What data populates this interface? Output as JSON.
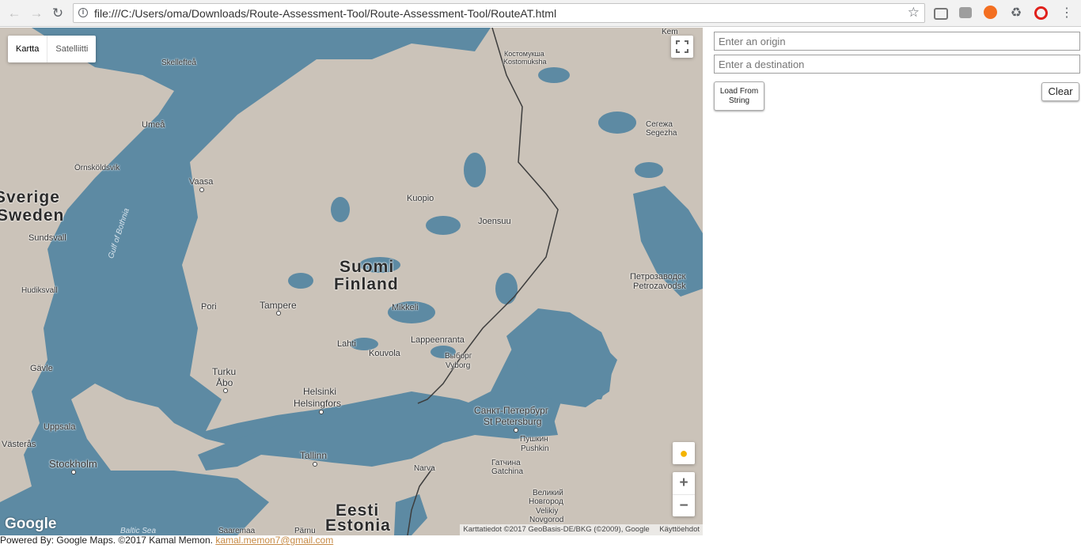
{
  "browser": {
    "url": "file:///C:/Users/oma/Downloads/Route-Assessment-Tool/Route-Assessment-Tool/RouteAT.html"
  },
  "map": {
    "type_controls": {
      "map_label": "Kartta",
      "satellite_label": "Satelliitti"
    },
    "labels": {
      "suomi": "Suomi",
      "finland": "Finland",
      "sverige": "Sverige",
      "sweden": "Sweden",
      "eesti": "Eesti",
      "estonia": "Estonia",
      "gulf_of_bothnia": "Gulf of Bothnia",
      "baltic_sea": "Baltic Sea",
      "skelleftea": "Skellefteå",
      "umea": "Umeå",
      "ornskoldsvik": "Örnsköldsvik",
      "vaasa": "Vaasa",
      "sundsvall": "Sundsvall",
      "hudiksvall": "Hudiksvall",
      "gavle": "Gävle",
      "uppsala": "Uppsala",
      "vasteras": "Västerås",
      "stockholm": "Stockholm",
      "pori": "Pori",
      "tampere": "Tampere",
      "turku": "Turku",
      "abo": "Åbo",
      "helsinki": "Helsinki",
      "helsingfors": "Helsingfors",
      "lahti": "Lahti",
      "kouvola": "Kouvola",
      "mikkeli": "Mikkeli",
      "kuopio": "Kuopio",
      "joensuu": "Joensuu",
      "lappeenranta": "Lappeenranta",
      "vyborg_ru": "Выборг",
      "vyborg": "Vyborg",
      "spb_ru": "Санкт-Петербург",
      "spb": "St Petersburg",
      "pushkin_ru": "Пушкин",
      "pushkin": "Pushkin",
      "gatchina_ru": "Гатчина",
      "gatchina": "Gatchina",
      "narva": "Narva",
      "tallinn": "Tallinn",
      "kostomuksha_ru": "Костомукша",
      "kostomuksha": "Kostomuksha",
      "segezha_ru": "Сегежа",
      "segezha": "Segezha",
      "petrozavodsk_ru": "Петрозаводск",
      "petrozavodsk": "Petrozavodsk",
      "velikiy_ru": "Великий",
      "novgorod_ru": "Новгород",
      "velikiy": "Velikiy",
      "novgorod": "Novgorod",
      "kem": "Kem",
      "saaremaa": "Saaremaa",
      "parnu": "Pärnu"
    },
    "logo": "Google",
    "attribution": "Karttatiedot ©2017 GeoBasis-DE/BKG (©2009), Google",
    "terms_label": "Käyttöehdot",
    "zoom_in": "+",
    "zoom_out": "−"
  },
  "panel": {
    "origin_placeholder": "Enter an origin",
    "destination_placeholder": "Enter a destination",
    "load_button": "Load From String",
    "clear_button": "Clear"
  },
  "footer": {
    "text": "Powered By: Google Maps. ©2017 Kamal Memon.",
    "email": "kamal.memon7@gmail.com"
  },
  "colors": {
    "water": "#5d8aa3",
    "land": "#cbc3b9",
    "link": "#c68a45"
  }
}
